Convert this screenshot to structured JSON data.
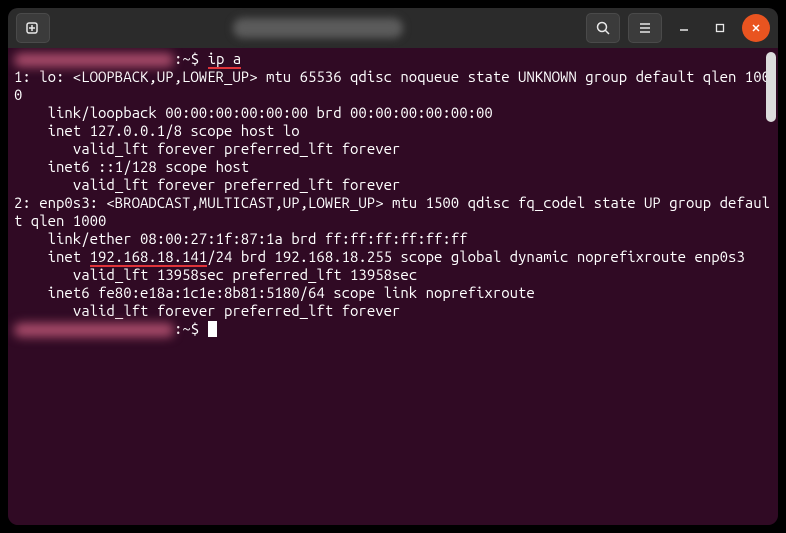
{
  "prompt": {
    "path": ":~$",
    "command": "ip a"
  },
  "output": {
    "line1": "1: lo: <LOOPBACK,UP,LOWER_UP> mtu 65536 qdisc noqueue state UNKNOWN group default qlen 1000",
    "line2": "    link/loopback 00:00:00:00:00:00 brd 00:00:00:00:00:00",
    "line3": "    inet 127.0.0.1/8 scope host lo",
    "line4": "       valid_lft forever preferred_lft forever",
    "line5": "    inet6 ::1/128 scope host ",
    "line6": "       valid_lft forever preferred_lft forever",
    "line7": "2: enp0s3: <BROADCAST,MULTICAST,UP,LOWER_UP> mtu 1500 qdisc fq_codel state UP group default qlen 1000",
    "line8": "    link/ether 08:00:27:1f:87:1a brd ff:ff:ff:ff:ff:ff",
    "line9_pre": "    inet ",
    "line9_ip": "192.168.18.141",
    "line9_post": "/24 brd 192.168.18.255 scope global dynamic noprefixroute enp0s3",
    "line10": "       valid_lft 13958sec preferred_lft 13958sec",
    "line11": "    inet6 fe80:e18a:1c1e:8b81:5180/64 scope link noprefixroute ",
    "line12": "       valid_lft forever preferred_lft forever"
  }
}
